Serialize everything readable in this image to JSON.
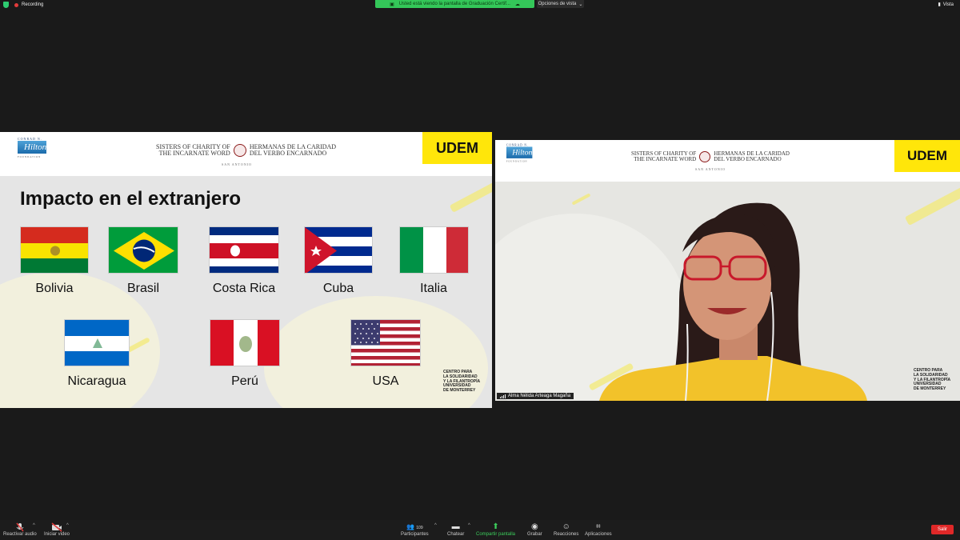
{
  "topbar": {
    "recording": "Recording",
    "share_banner": "Usted está viendo la pantalla de Graduación Certif...",
    "view_options": "Opciones de vista",
    "view": "Vista"
  },
  "slide": {
    "conrad": "CONRAD N.",
    "hilton": "Hilton",
    "foundation": "FOUNDATION",
    "sisters_line1": "SISTERS OF CHARITY OF",
    "sisters_line2": "THE INCARNATE WORD",
    "hermanas_line1": "HERMANAS DE LA CARIDAD",
    "hermanas_line2": "DEL VERBO ENCARNADO",
    "san_antonio": "SAN ANTONIO",
    "udem": "UDEM",
    "title": "Impacto en el extranjero",
    "countries": [
      {
        "name": "Bolivia",
        "flag": "bolivia-flag"
      },
      {
        "name": "Brasil",
        "flag": "brazil-flag"
      },
      {
        "name": "Costa Rica",
        "flag": "costa-rica-flag"
      },
      {
        "name": "Cuba",
        "flag": "cuba-flag"
      },
      {
        "name": "Italia",
        "flag": "italy-flag"
      },
      {
        "name": "Nicaragua",
        "flag": "nicaragua-flag"
      },
      {
        "name": "Perú",
        "flag": "peru-flag"
      },
      {
        "name": "USA",
        "flag": "usa-flag"
      }
    ],
    "centro": [
      "CENTRO PARA",
      "LA SOLIDARIDAD",
      "Y LA FILANTROPÍA",
      "UNIVERSIDAD",
      "DE MONTERREY"
    ]
  },
  "video": {
    "participant_name": "Alma Nélida Arteaga Magaña",
    "centro": [
      "CENTRO PARA",
      "LA SOLIDARIDAD",
      "Y LA FILANTROPÍA",
      "UNIVERSIDAD",
      "DE MONTERREY"
    ]
  },
  "toolbar": {
    "audio": "Reactivar audio",
    "video": "Iniciar video",
    "participants": "Participantes",
    "participants_count": "109",
    "chat": "Chatear",
    "share": "Compartir pantalla",
    "record": "Grabar",
    "reactions": "Reacciones",
    "apps": "Aplicaciones",
    "leave": "Salir"
  },
  "colors": {
    "udem_yellow": "#ffe60a",
    "share_green": "#34c759",
    "leave_red": "#e02828"
  }
}
